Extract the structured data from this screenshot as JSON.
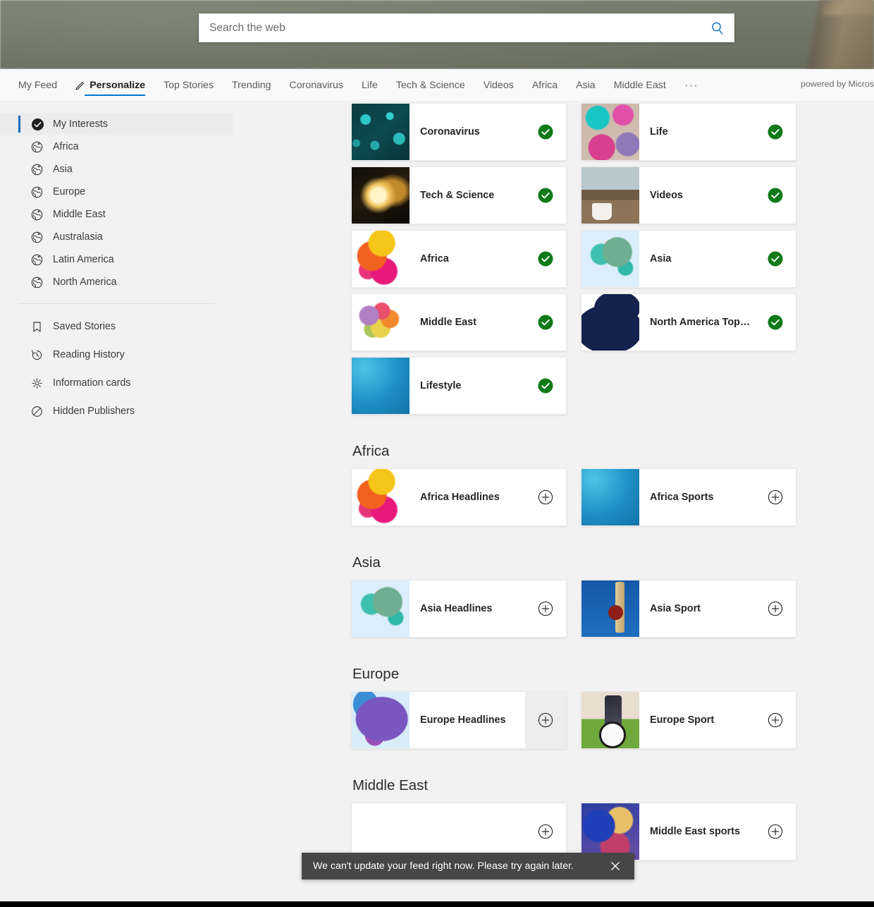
{
  "search": {
    "placeholder": "Search the web",
    "value": "",
    "icon": "search-icon"
  },
  "nav": {
    "items": [
      {
        "label": "My Feed",
        "active": false,
        "icon": null
      },
      {
        "label": "Personalize",
        "active": true,
        "icon": "pencil-icon"
      },
      {
        "label": "Top Stories",
        "active": false,
        "icon": null
      },
      {
        "label": "Trending",
        "active": false,
        "icon": null
      },
      {
        "label": "Coronavirus",
        "active": false,
        "icon": null
      },
      {
        "label": "Life",
        "active": false,
        "icon": null
      },
      {
        "label": "Tech & Science",
        "active": false,
        "icon": null
      },
      {
        "label": "Videos",
        "active": false,
        "icon": null
      },
      {
        "label": "Africa",
        "active": false,
        "icon": null
      },
      {
        "label": "Asia",
        "active": false,
        "icon": null
      },
      {
        "label": "Middle East",
        "active": false,
        "icon": null
      }
    ],
    "more_label": "···",
    "powered_by": "powered by Microsoft News"
  },
  "sidebar": {
    "interests": [
      {
        "label": "My Interests",
        "icon": "check-circle-filled-icon",
        "active": true
      },
      {
        "label": "Africa",
        "icon": "globe-icon",
        "active": false
      },
      {
        "label": "Asia",
        "icon": "globe-icon",
        "active": false
      },
      {
        "label": "Europe",
        "icon": "globe-icon",
        "active": false
      },
      {
        "label": "Middle East",
        "icon": "globe-icon",
        "active": false
      },
      {
        "label": "Australasia",
        "icon": "globe-icon",
        "active": false
      },
      {
        "label": "Latin America",
        "icon": "globe-icon",
        "active": false
      },
      {
        "label": "North America",
        "icon": "globe-icon",
        "active": false
      }
    ],
    "tools": [
      {
        "label": "Saved Stories",
        "icon": "bookmark-icon"
      },
      {
        "label": "Reading History",
        "icon": "history-icon"
      },
      {
        "label": "Information cards",
        "icon": "gear-icon"
      },
      {
        "label": "Hidden Publishers",
        "icon": "block-icon"
      }
    ]
  },
  "main": {
    "my_interests": [
      {
        "label": "Coronavirus",
        "state": "added",
        "action_icon": "check-circle-green-icon",
        "thumb": "t-corona"
      },
      {
        "label": "Life",
        "state": "added",
        "action_icon": "check-circle-green-icon",
        "thumb": "t-life"
      },
      {
        "label": "Tech & Science",
        "state": "added",
        "action_icon": "check-circle-green-icon",
        "thumb": "t-tech"
      },
      {
        "label": "Videos",
        "state": "added",
        "action_icon": "check-circle-green-icon",
        "thumb": "t-videos"
      },
      {
        "label": "Africa",
        "state": "added",
        "action_icon": "check-circle-green-icon",
        "thumb": "t-africa"
      },
      {
        "label": "Asia",
        "state": "added",
        "action_icon": "check-circle-green-icon",
        "thumb": "t-asia"
      },
      {
        "label": "Middle East",
        "state": "added",
        "action_icon": "check-circle-green-icon",
        "thumb": "t-mideast"
      },
      {
        "label": "North America Top…",
        "state": "added",
        "action_icon": "check-circle-green-icon",
        "thumb": "t-northam"
      },
      {
        "label": "Lifestyle",
        "state": "added",
        "action_icon": "check-circle-green-icon",
        "thumb": "t-lifestyle"
      }
    ],
    "sections": [
      {
        "title": "Africa",
        "cards": [
          {
            "label": "Africa Headlines",
            "state": "add",
            "action_icon": "plus-circle-icon",
            "thumb": "t-africa",
            "hovered": false
          },
          {
            "label": "Africa Sports",
            "state": "add",
            "action_icon": "plus-circle-icon",
            "thumb": "t-afrsports",
            "hovered": false
          }
        ]
      },
      {
        "title": "Asia",
        "cards": [
          {
            "label": "Asia Headlines",
            "state": "add",
            "action_icon": "plus-circle-icon",
            "thumb": "t-asia",
            "hovered": false
          },
          {
            "label": "Asia Sport",
            "state": "add",
            "action_icon": "plus-circle-icon",
            "thumb": "t-asiasport",
            "hovered": false
          }
        ]
      },
      {
        "title": "Europe",
        "cards": [
          {
            "label": "Europe Headlines",
            "state": "add",
            "action_icon": "plus-circle-icon",
            "thumb": "t-europe",
            "hovered": true
          },
          {
            "label": "Europe Sport",
            "state": "add",
            "action_icon": "plus-circle-icon",
            "thumb": "t-eursport",
            "hovered": false
          }
        ]
      },
      {
        "title": "Middle East",
        "cards": [
          {
            "label": "",
            "state": "add",
            "action_icon": "plus-circle-icon",
            "thumb": "t-mehead",
            "hovered": false
          },
          {
            "label": "Middle East sports",
            "state": "add",
            "action_icon": "plus-circle-icon",
            "thumb": "t-mesports",
            "hovered": false
          }
        ]
      }
    ]
  },
  "toast": {
    "message": "We can't update your feed right now. Please try again later.",
    "close_icon": "close-icon"
  },
  "colors": {
    "accent": "#0078d4",
    "added_green": "#107c10",
    "toast_bg": "#464646",
    "nav_bg": "#f9f9f9",
    "page_bg": "#f2f2f2"
  }
}
